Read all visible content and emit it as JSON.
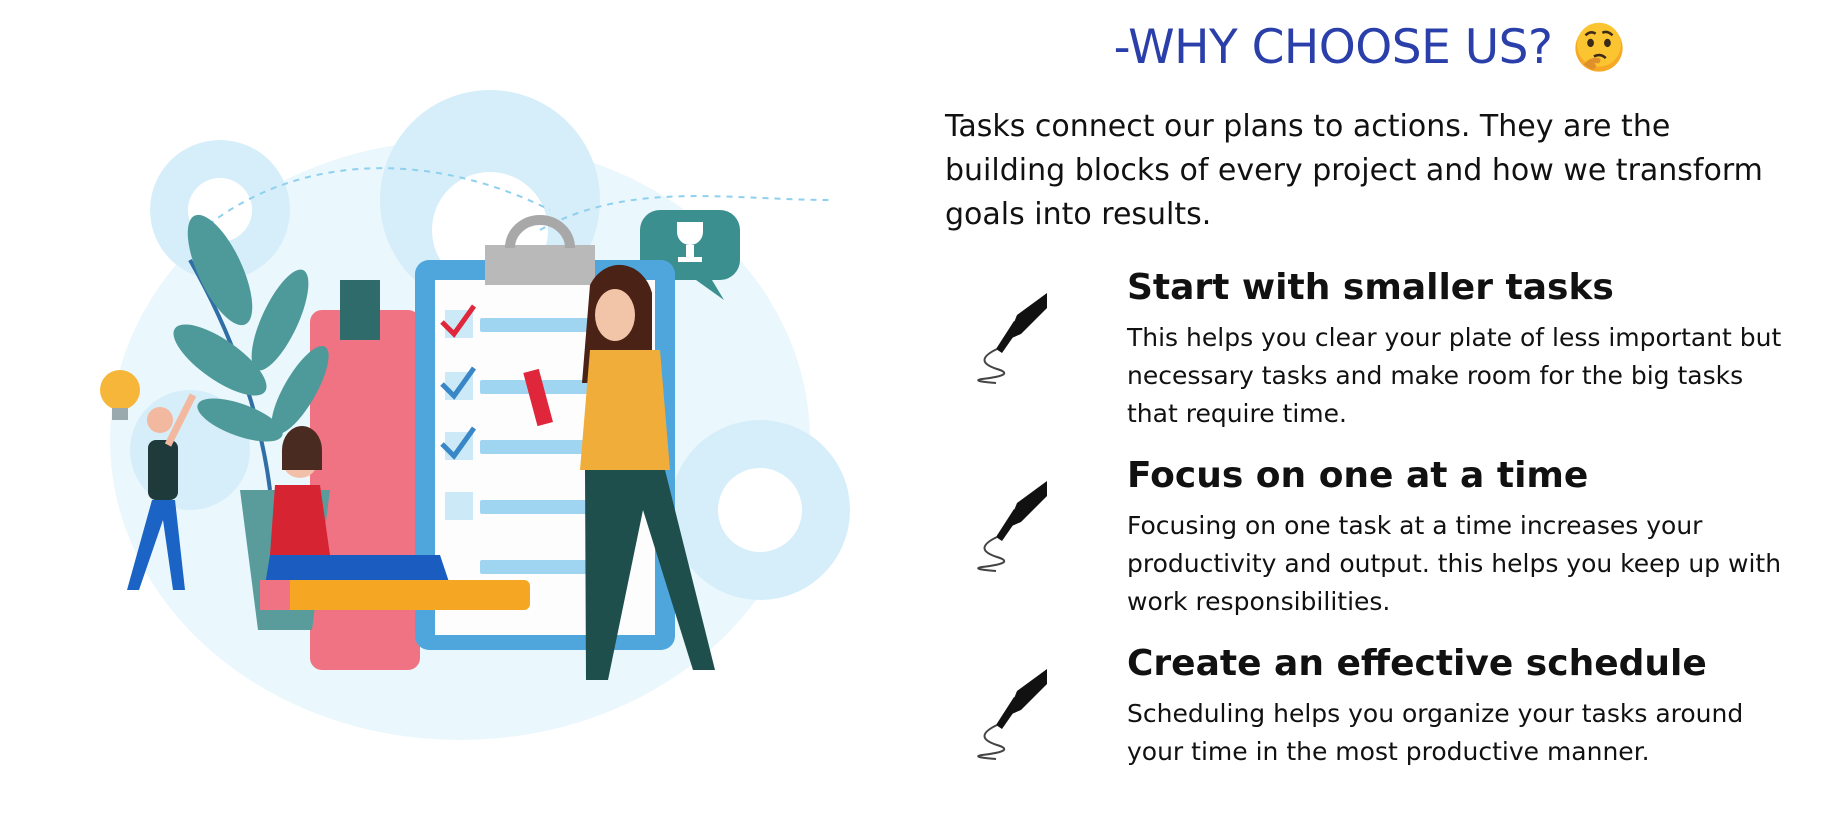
{
  "heading": {
    "text": "-WHY CHOOSE US?",
    "emoji_icon": "thinking-face-icon",
    "color": "#2a3faa"
  },
  "intro": "Tasks connect our plans to actions. They are the building blocks of every project and how we transform goals into results.",
  "features": [
    {
      "icon": "quill-pen-icon",
      "title": "Start with smaller tasks",
      "description": "This helps you clear your plate of less important but necessary tasks and make room for the big tasks that require time."
    },
    {
      "icon": "quill-pen-icon",
      "title": "Focus on one at a time",
      "description": "Focusing on one task at a time increases your productivity and output. this helps you keep up with work responsibilities."
    },
    {
      "icon": "quill-pen-icon",
      "title": "Create an effective schedule",
      "description": "Scheduling helps you organize your tasks around your time in the most productive manner."
    }
  ],
  "illustration": {
    "icon": "task-checklist-illustration",
    "colors": {
      "light_blue": "#dff3fc",
      "clipboard_blue": "#4fa6dc",
      "check_red": "#e0263b",
      "check_blue": "#3a87c7",
      "teal": "#4e9a9a",
      "dark_teal": "#1f4f4c",
      "mustard": "#f0ad3a",
      "red_shirt": "#d62433",
      "book_pink": "#f07383"
    }
  }
}
